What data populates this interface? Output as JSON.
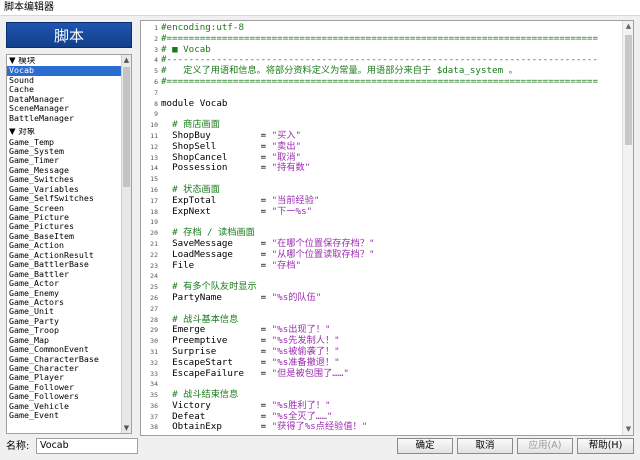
{
  "window": {
    "title": "脚本编辑器"
  },
  "left_header": "脚本",
  "script_list": {
    "sections": [
      {
        "label": "▼ 模块",
        "items": [
          "Vocab",
          "Sound",
          "Cache",
          "DataManager",
          "SceneManager",
          "BattleManager"
        ]
      },
      {
        "label": "▼ 对象",
        "items": [
          "Game_Temp",
          "Game_System",
          "Game_Timer",
          "Game_Message",
          "Game_Switches",
          "Game_Variables",
          "Game_SelfSwitches",
          "Game_Screen",
          "Game_Picture",
          "Game_Pictures",
          "Game_BaseItem",
          "Game_Action",
          "Game_ActionResult",
          "Game_BattlerBase",
          "Game_Battler",
          "Game_Actor",
          "Game_Enemy",
          "Game_Actors",
          "Game_Unit",
          "Game_Party",
          "Game_Troop",
          "Game_Map",
          "Game_CommonEvent",
          "Game_CharacterBase",
          "Game_Character",
          "Game_Player",
          "Game_Follower",
          "Game_Followers",
          "Game_Vehicle",
          "Game_Event"
        ]
      }
    ],
    "selected": "Vocab"
  },
  "editor": {
    "lines": [
      {
        "n": "1",
        "t": "#encoding:utf-8",
        "c": "comment"
      },
      {
        "n": "2",
        "t": "#==============================================================================",
        "c": "comment"
      },
      {
        "n": "3",
        "t": "# ■ Vocab",
        "c": "comment"
      },
      {
        "n": "4",
        "t": "#------------------------------------------------------------------------------",
        "c": "comment"
      },
      {
        "n": "5",
        "t": "#   定义了用语和信息。将部分资料定义为常量。用语部分来自于 $data_system 。",
        "c": "comment"
      },
      {
        "n": "6",
        "t": "#==============================================================================",
        "c": "comment"
      },
      {
        "n": "7",
        "t": "",
        "c": "kw"
      },
      {
        "n": "8",
        "t": "module Vocab",
        "c": "kw"
      },
      {
        "n": "9",
        "t": "",
        "c": "kw"
      },
      {
        "n": "10",
        "t": "  # 商店画面",
        "c": "comment"
      },
      {
        "n": "11",
        "k": "  ShopBuy         = ",
        "s": "\"买入\""
      },
      {
        "n": "12",
        "k": "  ShopSell        = ",
        "s": "\"卖出\""
      },
      {
        "n": "13",
        "k": "  ShopCancel      = ",
        "s": "\"取消\""
      },
      {
        "n": "14",
        "k": "  Possession      = ",
        "s": "\"持有数\""
      },
      {
        "n": "15",
        "t": "",
        "c": "kw"
      },
      {
        "n": "16",
        "t": "  # 状态画面",
        "c": "comment"
      },
      {
        "n": "17",
        "k": "  ExpTotal        = ",
        "s": "\"当前经验\""
      },
      {
        "n": "18",
        "k": "  ExpNext         = ",
        "s": "\"下一%s\""
      },
      {
        "n": "19",
        "t": "",
        "c": "kw"
      },
      {
        "n": "20",
        "t": "  # 存档 / 读档画面",
        "c": "comment"
      },
      {
        "n": "21",
        "k": "  SaveMessage     = ",
        "s": "\"在哪个位置保存存档？\""
      },
      {
        "n": "22",
        "k": "  LoadMessage     = ",
        "s": "\"从哪个位置读取存档？\""
      },
      {
        "n": "23",
        "k": "  File            = ",
        "s": "\"存档\""
      },
      {
        "n": "24",
        "t": "",
        "c": "kw"
      },
      {
        "n": "25",
        "t": "  # 有多个队友时显示",
        "c": "comment"
      },
      {
        "n": "26",
        "k": "  PartyName       = ",
        "s": "\"%s的队伍\""
      },
      {
        "n": "27",
        "t": "",
        "c": "kw"
      },
      {
        "n": "28",
        "t": "  # 战斗基本信息",
        "c": "comment"
      },
      {
        "n": "29",
        "k": "  Emerge          = ",
        "s": "\"%s出现了！\""
      },
      {
        "n": "30",
        "k": "  Preemptive      = ",
        "s": "\"%s先发制人！\""
      },
      {
        "n": "31",
        "k": "  Surprise        = ",
        "s": "\"%s被偷袭了！\""
      },
      {
        "n": "32",
        "k": "  EscapeStart     = ",
        "s": "\"%s准备撤退！\""
      },
      {
        "n": "33",
        "k": "  EscapeFailure   = ",
        "s": "\"但是被包围了……\""
      },
      {
        "n": "34",
        "t": "",
        "c": "kw"
      },
      {
        "n": "35",
        "t": "  # 战斗结束信息",
        "c": "comment"
      },
      {
        "n": "36",
        "k": "  Victory         = ",
        "s": "\"%s胜利了！\""
      },
      {
        "n": "37",
        "k": "  Defeat          = ",
        "s": "\"%s全灭了……\""
      },
      {
        "n": "38",
        "k": "  ObtainExp       = ",
        "s": "\"获得了%s点经验值！\""
      }
    ]
  },
  "name_field": {
    "label": "名称:",
    "value": "Vocab"
  },
  "buttons": {
    "ok": "确定",
    "cancel": "取消",
    "apply": "应用(A)",
    "help": "帮助(H)"
  }
}
